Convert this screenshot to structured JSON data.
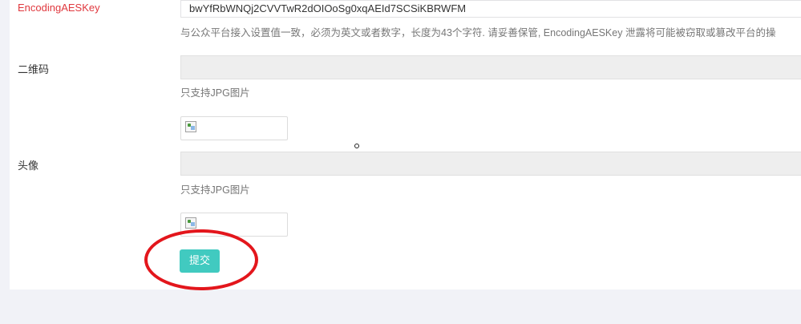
{
  "aes_key": {
    "label": "EncodingAESKey",
    "value": "bwYfRbWNQj2CVVTwR2dOIOoSg0xqAEId7SCSiKBRWFM",
    "help": "与公众平台接入设置值一致，必须为英文或者数字，长度为43个字符. 请妥善保管, EncodingAESKey 泄露将可能被窃取或篡改平台的操"
  },
  "qrcode": {
    "label": "二维码",
    "value": "",
    "help": "只支持JPG图片"
  },
  "avatar": {
    "label": "头像",
    "value": "",
    "help": "只支持JPG图片"
  },
  "submit_label": "提交",
  "colors": {
    "accent": "#41cac0",
    "required_label": "#e0383e",
    "annotation": "#e3161c"
  },
  "icons": {
    "image_preview": "broken-image-icon",
    "cursor": "mouse-cursor-icon"
  }
}
